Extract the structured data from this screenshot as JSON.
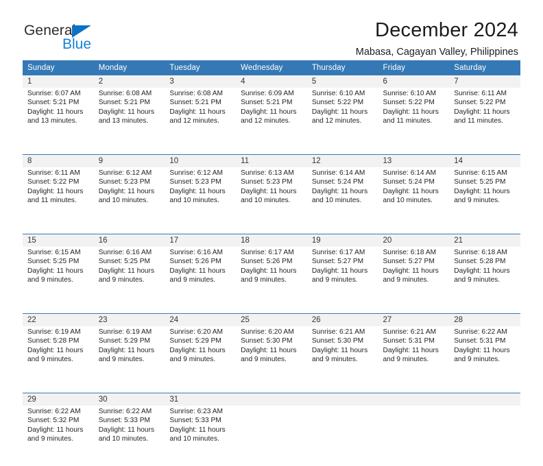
{
  "brand": {
    "name_part1": "General",
    "name_part2": "Blue",
    "triangle_color": "#0b72c4",
    "blue_color": "#1283d4"
  },
  "header": {
    "title": "December 2024",
    "subtitle": "Mabasa, Cagayan Valley, Philippines",
    "accent_color": "#3479b5"
  },
  "weekdays": [
    "Sunday",
    "Monday",
    "Tuesday",
    "Wednesday",
    "Thursday",
    "Friday",
    "Saturday"
  ],
  "weeks": [
    [
      {
        "day": "1",
        "sunrise": "Sunrise: 6:07 AM",
        "sunset": "Sunset: 5:21 PM",
        "daylight1": "Daylight: 11 hours",
        "daylight2": "and 13 minutes."
      },
      {
        "day": "2",
        "sunrise": "Sunrise: 6:08 AM",
        "sunset": "Sunset: 5:21 PM",
        "daylight1": "Daylight: 11 hours",
        "daylight2": "and 13 minutes."
      },
      {
        "day": "3",
        "sunrise": "Sunrise: 6:08 AM",
        "sunset": "Sunset: 5:21 PM",
        "daylight1": "Daylight: 11 hours",
        "daylight2": "and 12 minutes."
      },
      {
        "day": "4",
        "sunrise": "Sunrise: 6:09 AM",
        "sunset": "Sunset: 5:21 PM",
        "daylight1": "Daylight: 11 hours",
        "daylight2": "and 12 minutes."
      },
      {
        "day": "5",
        "sunrise": "Sunrise: 6:10 AM",
        "sunset": "Sunset: 5:22 PM",
        "daylight1": "Daylight: 11 hours",
        "daylight2": "and 12 minutes."
      },
      {
        "day": "6",
        "sunrise": "Sunrise: 6:10 AM",
        "sunset": "Sunset: 5:22 PM",
        "daylight1": "Daylight: 11 hours",
        "daylight2": "and 11 minutes."
      },
      {
        "day": "7",
        "sunrise": "Sunrise: 6:11 AM",
        "sunset": "Sunset: 5:22 PM",
        "daylight1": "Daylight: 11 hours",
        "daylight2": "and 11 minutes."
      }
    ],
    [
      {
        "day": "8",
        "sunrise": "Sunrise: 6:11 AM",
        "sunset": "Sunset: 5:22 PM",
        "daylight1": "Daylight: 11 hours",
        "daylight2": "and 11 minutes."
      },
      {
        "day": "9",
        "sunrise": "Sunrise: 6:12 AM",
        "sunset": "Sunset: 5:23 PM",
        "daylight1": "Daylight: 11 hours",
        "daylight2": "and 10 minutes."
      },
      {
        "day": "10",
        "sunrise": "Sunrise: 6:12 AM",
        "sunset": "Sunset: 5:23 PM",
        "daylight1": "Daylight: 11 hours",
        "daylight2": "and 10 minutes."
      },
      {
        "day": "11",
        "sunrise": "Sunrise: 6:13 AM",
        "sunset": "Sunset: 5:23 PM",
        "daylight1": "Daylight: 11 hours",
        "daylight2": "and 10 minutes."
      },
      {
        "day": "12",
        "sunrise": "Sunrise: 6:14 AM",
        "sunset": "Sunset: 5:24 PM",
        "daylight1": "Daylight: 11 hours",
        "daylight2": "and 10 minutes."
      },
      {
        "day": "13",
        "sunrise": "Sunrise: 6:14 AM",
        "sunset": "Sunset: 5:24 PM",
        "daylight1": "Daylight: 11 hours",
        "daylight2": "and 10 minutes."
      },
      {
        "day": "14",
        "sunrise": "Sunrise: 6:15 AM",
        "sunset": "Sunset: 5:25 PM",
        "daylight1": "Daylight: 11 hours",
        "daylight2": "and 9 minutes."
      }
    ],
    [
      {
        "day": "15",
        "sunrise": "Sunrise: 6:15 AM",
        "sunset": "Sunset: 5:25 PM",
        "daylight1": "Daylight: 11 hours",
        "daylight2": "and 9 minutes."
      },
      {
        "day": "16",
        "sunrise": "Sunrise: 6:16 AM",
        "sunset": "Sunset: 5:25 PM",
        "daylight1": "Daylight: 11 hours",
        "daylight2": "and 9 minutes."
      },
      {
        "day": "17",
        "sunrise": "Sunrise: 6:16 AM",
        "sunset": "Sunset: 5:26 PM",
        "daylight1": "Daylight: 11 hours",
        "daylight2": "and 9 minutes."
      },
      {
        "day": "18",
        "sunrise": "Sunrise: 6:17 AM",
        "sunset": "Sunset: 5:26 PM",
        "daylight1": "Daylight: 11 hours",
        "daylight2": "and 9 minutes."
      },
      {
        "day": "19",
        "sunrise": "Sunrise: 6:17 AM",
        "sunset": "Sunset: 5:27 PM",
        "daylight1": "Daylight: 11 hours",
        "daylight2": "and 9 minutes."
      },
      {
        "day": "20",
        "sunrise": "Sunrise: 6:18 AM",
        "sunset": "Sunset: 5:27 PM",
        "daylight1": "Daylight: 11 hours",
        "daylight2": "and 9 minutes."
      },
      {
        "day": "21",
        "sunrise": "Sunrise: 6:18 AM",
        "sunset": "Sunset: 5:28 PM",
        "daylight1": "Daylight: 11 hours",
        "daylight2": "and 9 minutes."
      }
    ],
    [
      {
        "day": "22",
        "sunrise": "Sunrise: 6:19 AM",
        "sunset": "Sunset: 5:28 PM",
        "daylight1": "Daylight: 11 hours",
        "daylight2": "and 9 minutes."
      },
      {
        "day": "23",
        "sunrise": "Sunrise: 6:19 AM",
        "sunset": "Sunset: 5:29 PM",
        "daylight1": "Daylight: 11 hours",
        "daylight2": "and 9 minutes."
      },
      {
        "day": "24",
        "sunrise": "Sunrise: 6:20 AM",
        "sunset": "Sunset: 5:29 PM",
        "daylight1": "Daylight: 11 hours",
        "daylight2": "and 9 minutes."
      },
      {
        "day": "25",
        "sunrise": "Sunrise: 6:20 AM",
        "sunset": "Sunset: 5:30 PM",
        "daylight1": "Daylight: 11 hours",
        "daylight2": "and 9 minutes."
      },
      {
        "day": "26",
        "sunrise": "Sunrise: 6:21 AM",
        "sunset": "Sunset: 5:30 PM",
        "daylight1": "Daylight: 11 hours",
        "daylight2": "and 9 minutes."
      },
      {
        "day": "27",
        "sunrise": "Sunrise: 6:21 AM",
        "sunset": "Sunset: 5:31 PM",
        "daylight1": "Daylight: 11 hours",
        "daylight2": "and 9 minutes."
      },
      {
        "day": "28",
        "sunrise": "Sunrise: 6:22 AM",
        "sunset": "Sunset: 5:31 PM",
        "daylight1": "Daylight: 11 hours",
        "daylight2": "and 9 minutes."
      }
    ],
    [
      {
        "day": "29",
        "sunrise": "Sunrise: 6:22 AM",
        "sunset": "Sunset: 5:32 PM",
        "daylight1": "Daylight: 11 hours",
        "daylight2": "and 9 minutes."
      },
      {
        "day": "30",
        "sunrise": "Sunrise: 6:22 AM",
        "sunset": "Sunset: 5:33 PM",
        "daylight1": "Daylight: 11 hours",
        "daylight2": "and 10 minutes."
      },
      {
        "day": "31",
        "sunrise": "Sunrise: 6:23 AM",
        "sunset": "Sunset: 5:33 PM",
        "daylight1": "Daylight: 11 hours",
        "daylight2": "and 10 minutes."
      },
      {
        "day": "",
        "sunrise": "",
        "sunset": "",
        "daylight1": "",
        "daylight2": ""
      },
      {
        "day": "",
        "sunrise": "",
        "sunset": "",
        "daylight1": "",
        "daylight2": ""
      },
      {
        "day": "",
        "sunrise": "",
        "sunset": "",
        "daylight1": "",
        "daylight2": ""
      },
      {
        "day": "",
        "sunrise": "",
        "sunset": "",
        "daylight1": "",
        "daylight2": ""
      }
    ]
  ]
}
